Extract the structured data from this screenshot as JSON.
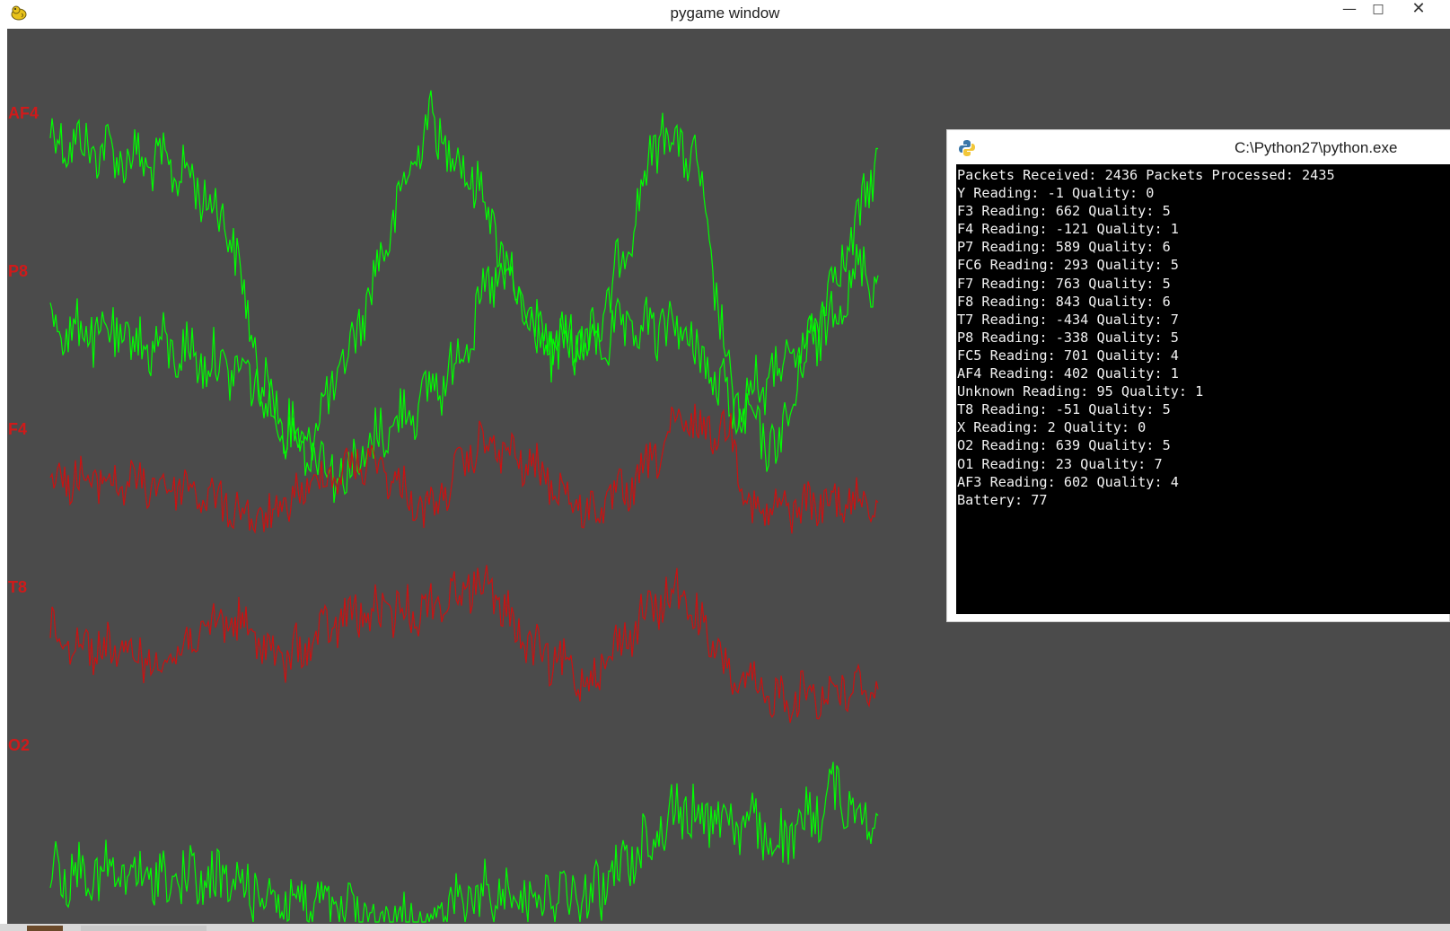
{
  "main_window": {
    "title": "pygame window",
    "icon": "pygame-snake-icon",
    "controls": [
      "minimize-icon",
      "maximize-icon",
      "close-icon"
    ]
  },
  "channels": [
    {
      "label": "AF4",
      "color": "#00ff00"
    },
    {
      "label": "P8",
      "color": "#00ff00"
    },
    {
      "label": "F4",
      "color": "#cc1111"
    },
    {
      "label": "T8",
      "color": "#cc1111"
    },
    {
      "label": "O2",
      "color": "#00ff00"
    }
  ],
  "colors": {
    "canvas_bg": "#4b4b4b",
    "label_red": "#d01a1a",
    "trace_green": "#00ff00",
    "trace_red": "#cc1111",
    "console_bg": "#000000",
    "console_text": "#f2f2f2"
  },
  "console": {
    "title": "C:\\Python27\\python.exe",
    "icon": "python-icon",
    "lines": [
      "Packets Received: 2436 Packets Processed: 2435",
      "Y Reading: -1 Quality: 0",
      "F3 Reading: 662 Quality: 5",
      "F4 Reading: -121 Quality: 1",
      "P7 Reading: 589 Quality: 6",
      "FC6 Reading: 293 Quality: 5",
      "F7 Reading: 763 Quality: 5",
      "F8 Reading: 843 Quality: 6",
      "T7 Reading: -434 Quality: 7",
      "P8 Reading: -338 Quality: 5",
      "FC5 Reading: 701 Quality: 4",
      "AF4 Reading: 402 Quality: 1",
      "Unknown Reading: 95 Quality: 1",
      "T8 Reading: -51 Quality: 5",
      "X Reading: 2 Quality: 0",
      "O2 Reading: 639 Quality: 5",
      "O1 Reading: 23 Quality: 7",
      "AF3 Reading: 602 Quality: 4",
      "Battery: 77"
    ]
  }
}
